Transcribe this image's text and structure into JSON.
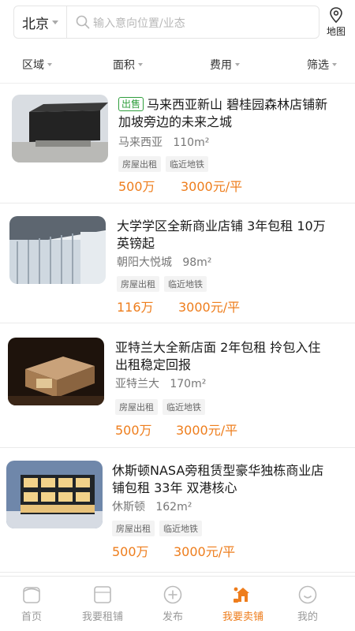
{
  "header": {
    "city": "北京",
    "search_placeholder": "输入意向位置/业态",
    "map_label": "地图"
  },
  "filters": [
    "区域",
    "面积",
    "费用",
    "筛选"
  ],
  "listings": [
    {
      "badge": "出售",
      "title": "马来西亚新山 碧桂园森林店铺新加坡旁边的未来之城",
      "location": "马来西亚",
      "area": "110m²",
      "tags": [
        "房屋出租",
        "临近地铁"
      ],
      "price": "500万",
      "rent": "3000元/平"
    },
    {
      "badge": "",
      "title": "大学学区全新商业店铺 3年包租 10万英镑起",
      "location": "朝阳大悦城",
      "area": "98m²",
      "tags": [
        "房屋出租",
        "临近地铁"
      ],
      "price": "116万",
      "rent": "3000元/平"
    },
    {
      "badge": "",
      "title": "亚特兰大全新店面 2年包租 拎包入住 出租稳定回报",
      "location": "亚特兰大",
      "area": "170m²",
      "tags": [
        "房屋出租",
        "临近地铁"
      ],
      "price": "500万",
      "rent": "3000元/平"
    },
    {
      "badge": "",
      "title": "休斯顿NASA旁租赁型豪华独栋商业店铺包租 33年 双港核心",
      "location": "休斯顿",
      "area": "162m²",
      "tags": [
        "房屋出租",
        "临近地铁"
      ],
      "price": "500万",
      "rent": "3000元/平"
    }
  ],
  "tabbar": [
    {
      "label": "首页",
      "icon": "home-icon"
    },
    {
      "label": "我要租铺",
      "icon": "rent-shop-icon"
    },
    {
      "label": "发布",
      "icon": "publish-icon"
    },
    {
      "label": "我要卖铺",
      "icon": "sell-shop-icon",
      "active": true
    },
    {
      "label": "我的",
      "icon": "profile-icon"
    }
  ],
  "colors": {
    "accent": "#ee7d1c",
    "sale_badge": "#2f9e3d"
  }
}
